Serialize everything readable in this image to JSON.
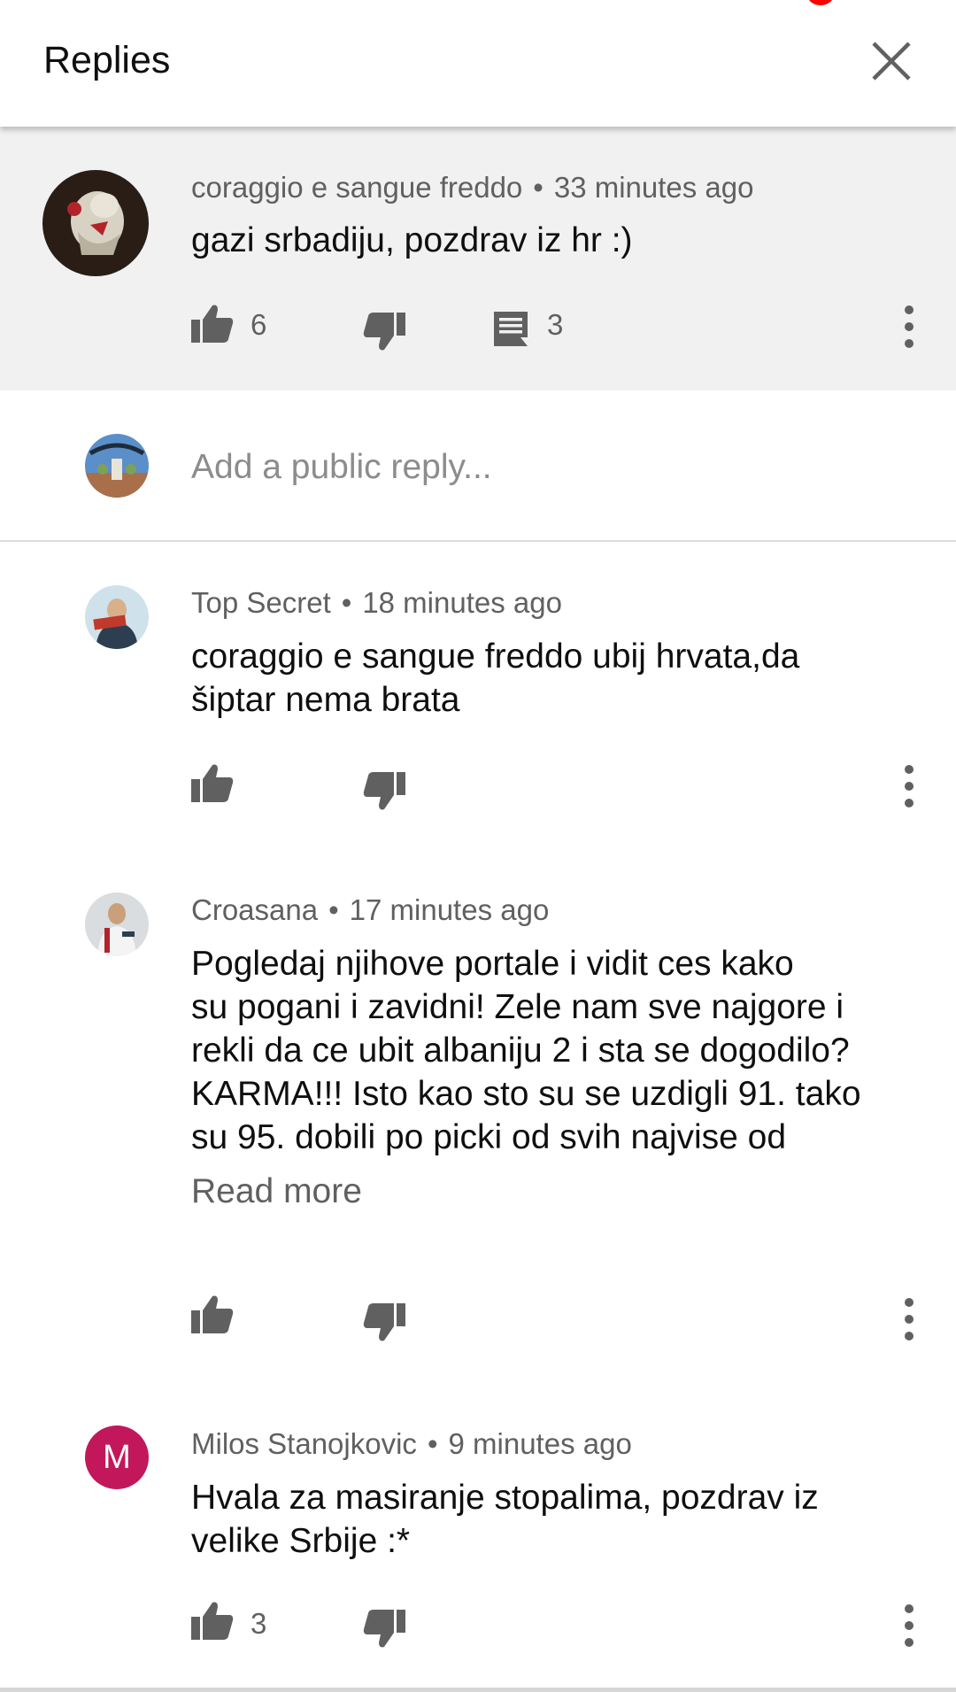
{
  "header": {
    "title": "Replies",
    "close_icon": "close-icon"
  },
  "parent_comment": {
    "author": "coraggio e sangue freddo",
    "time": "33 minutes ago",
    "text": "gazi srbadiju, pozdrav iz hr :)",
    "likes": "6",
    "replies": "3"
  },
  "reply_box": {
    "placeholder": "Add a public reply..."
  },
  "replies": [
    {
      "author": "Top Secret",
      "time": "18 minutes ago",
      "text_lines": [
        "coraggio e sangue freddo ubij hrvata,da",
        "šiptar nema brata"
      ]
    },
    {
      "author": "Croasana",
      "time": "17 minutes ago",
      "text_lines": [
        "Pogledaj njihove portale i vidit ces kako",
        "su pogani i zavidni! Zele nam sve najgore i",
        "rekli da ce ubit albaniju 2 i sta se dogodilo?",
        "KARMA!!! Isto kao sto su se uzdigli 91. tako",
        "su 95. dobili po picki od svih najvise od"
      ],
      "read_more": "Read more"
    },
    {
      "author": "Milos Stanojkovic",
      "time": "9 minutes ago",
      "avatar_letter": "M",
      "text_lines": [
        "Hvala za masiranje stopalima, pozdrav iz",
        "velike Srbije :*"
      ],
      "likes": "3"
    }
  ],
  "colors": {
    "accent_notification": "#ff0000",
    "avatar_letter_bg": "#c2185b",
    "parent_bg": "#f1f1f1",
    "icon_gray": "#606060"
  }
}
